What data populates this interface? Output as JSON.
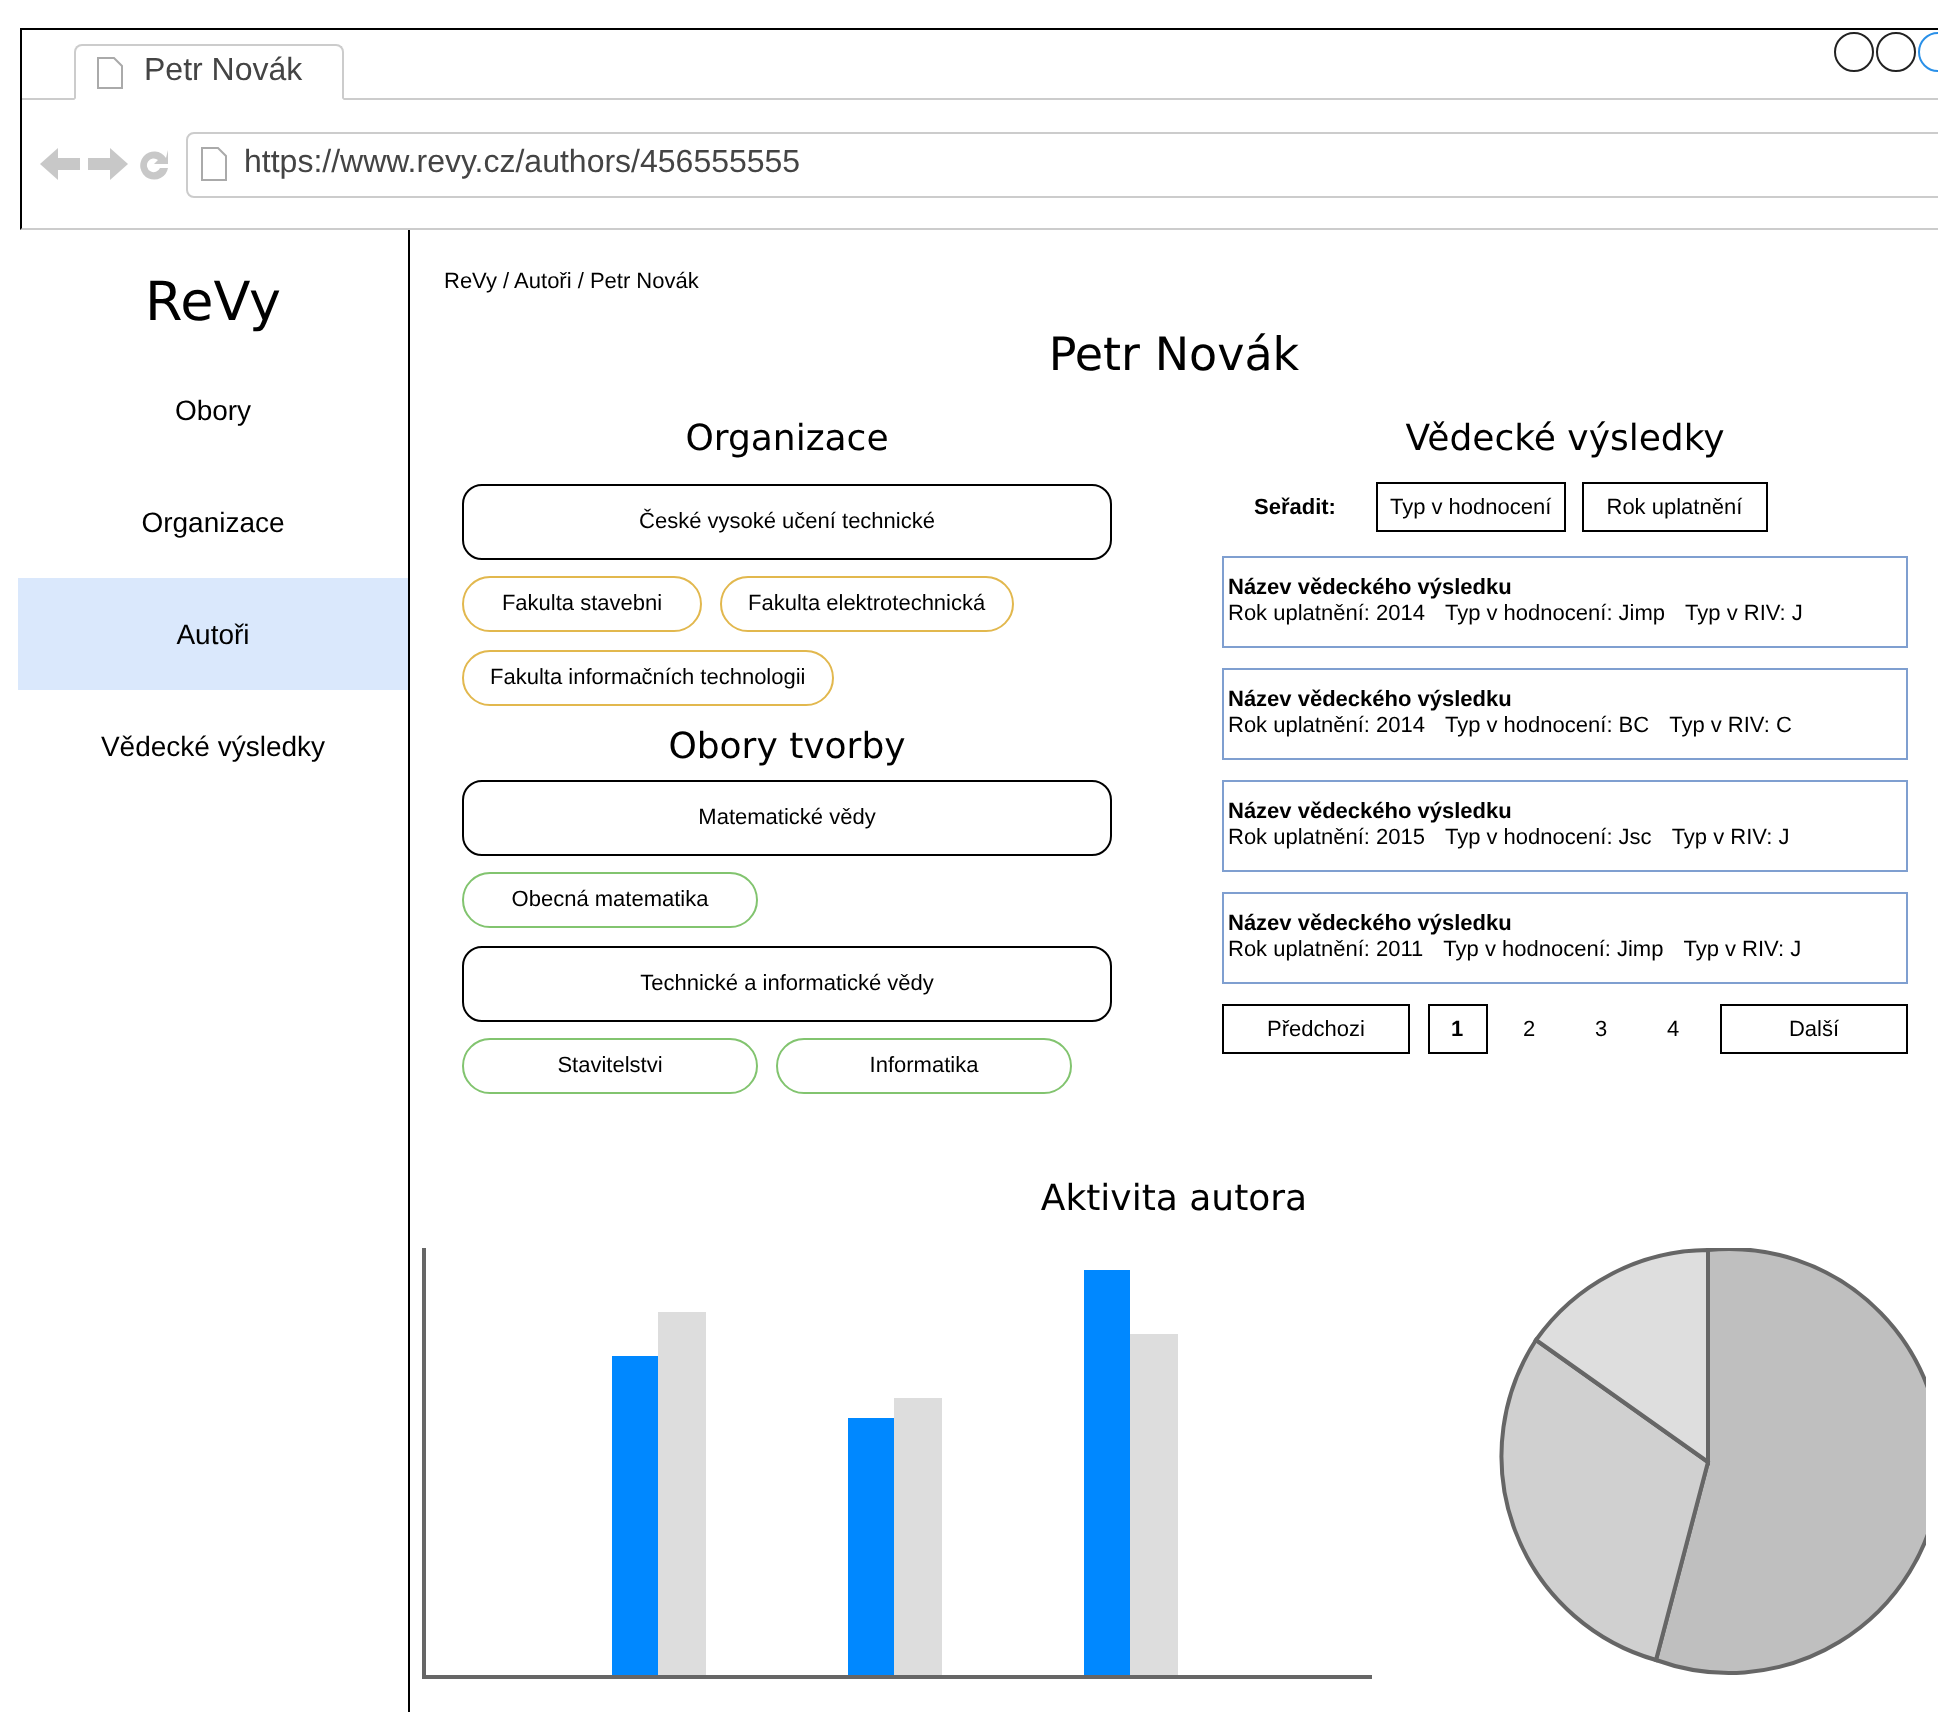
{
  "browser": {
    "tab_title": "Petr Novák",
    "url": "https://www.revy.cz/authors/456555555"
  },
  "sidebar": {
    "brand": "ReVy",
    "items": [
      {
        "label": "Obory",
        "selected": false
      },
      {
        "label": "Organizace",
        "selected": false
      },
      {
        "label": "Autoři",
        "selected": true
      },
      {
        "label": "Vědecké výsledky",
        "selected": false
      }
    ]
  },
  "breadcrumb": "ReVy / Autoři / Petr Novák",
  "title": "Petr Novák",
  "organizations": {
    "heading": "Organizace",
    "groups": [
      {
        "name": "České vysoké učení technické",
        "children": [
          "Fakulta stavebni",
          "Fakulta elektrotechnická",
          "Fakulta informačních technologii"
        ]
      }
    ]
  },
  "fields": {
    "heading": "Obory tvorby",
    "groups": [
      {
        "name": "Matematické vědy",
        "children": [
          "Obecná matematika"
        ]
      },
      {
        "name": "Technické a informatické vědy",
        "children": [
          "Stavitelstvi",
          "Informatika"
        ]
      }
    ]
  },
  "results": {
    "heading": "Vědecké výsledky",
    "sort_label": "Seřadit:",
    "sort_buttons": [
      "Typ v hodnocení",
      "Rok uplatnění"
    ],
    "items": [
      {
        "title": "Název vědeckého výsledku",
        "meta": [
          "Rok uplatnění: 2014",
          "Typ v hodnocení: Jimp",
          "Typ v RIV: J"
        ]
      },
      {
        "title": "Název vědeckého výsledku",
        "meta": [
          "Rok uplatnění: 2014",
          "Typ v hodnocení: BC",
          "Typ v RIV: C"
        ]
      },
      {
        "title": "Název vědeckého výsledku",
        "meta": [
          "Rok uplatnění: 2015",
          "Typ v hodnocení: Jsc",
          "Typ v RIV: J"
        ]
      },
      {
        "title": "Název vědeckého výsledku",
        "meta": [
          "Rok uplatnění: 2011",
          "Typ v hodnocení: Jimp",
          "Typ v RIV: J"
        ]
      }
    ],
    "pagination": {
      "previous": "Předchozi",
      "next": "Další",
      "pages": [
        {
          "label": "1",
          "selected": true
        },
        {
          "label": "2",
          "selected": false
        },
        {
          "label": "3",
          "selected": false
        },
        {
          "label": "4",
          "selected": false
        }
      ]
    }
  },
  "activity": {
    "heading": "Aktivita autora"
  }
}
